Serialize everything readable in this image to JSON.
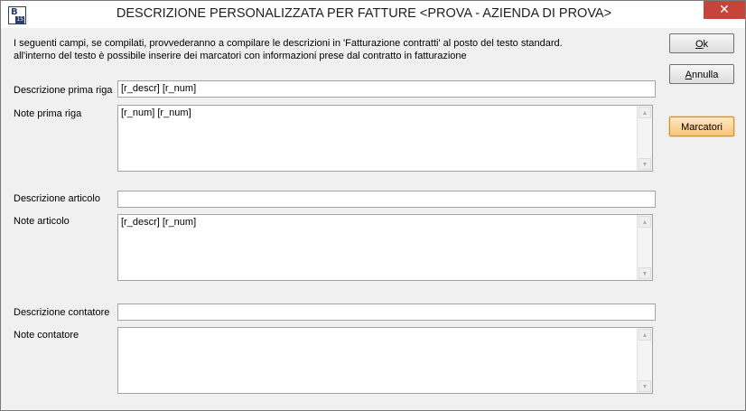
{
  "window": {
    "title": "DESCRIZIONE PERSONALIZZATA PER FATTURE <PROVA - AZIENDA DI PROVA>",
    "icon_letter": "B",
    "icon_badge": "15",
    "close_glyph": "✕"
  },
  "info": {
    "line1": "I seguenti campi, se compilati, provvederanno a compilare le descrizioni in 'Fatturazione contratti' al posto del testo standard.",
    "line2": "all'interno del testo è possibile inserire dei marcatori con informazioni prese dal contratto in fatturazione"
  },
  "form": {
    "descr_prima_riga": {
      "label": "Descrizione prima riga",
      "value": "[r_descr] [r_num]"
    },
    "note_prima_riga": {
      "label": "Note prima riga",
      "value": "[r_num] [r_num]"
    },
    "descr_articolo": {
      "label": "Descrizione articolo",
      "value": ""
    },
    "note_articolo": {
      "label": "Note articolo",
      "value": "[r_descr] [r_num]"
    },
    "descr_contatore": {
      "label": "Descrizione contatore",
      "value": ""
    },
    "note_contatore": {
      "label": "Note contatore",
      "value": ""
    }
  },
  "buttons": {
    "ok": {
      "hotkey": "O",
      "rest": "k"
    },
    "annulla": {
      "hotkey": "A",
      "rest": "nnulla"
    },
    "marcatori": {
      "label": "Marcatori"
    }
  },
  "colors": {
    "close_button": "#c7443a",
    "marcatori_button": "#f9c57b"
  },
  "icons": {
    "scroll_up": "▲",
    "scroll_down": "▼"
  }
}
